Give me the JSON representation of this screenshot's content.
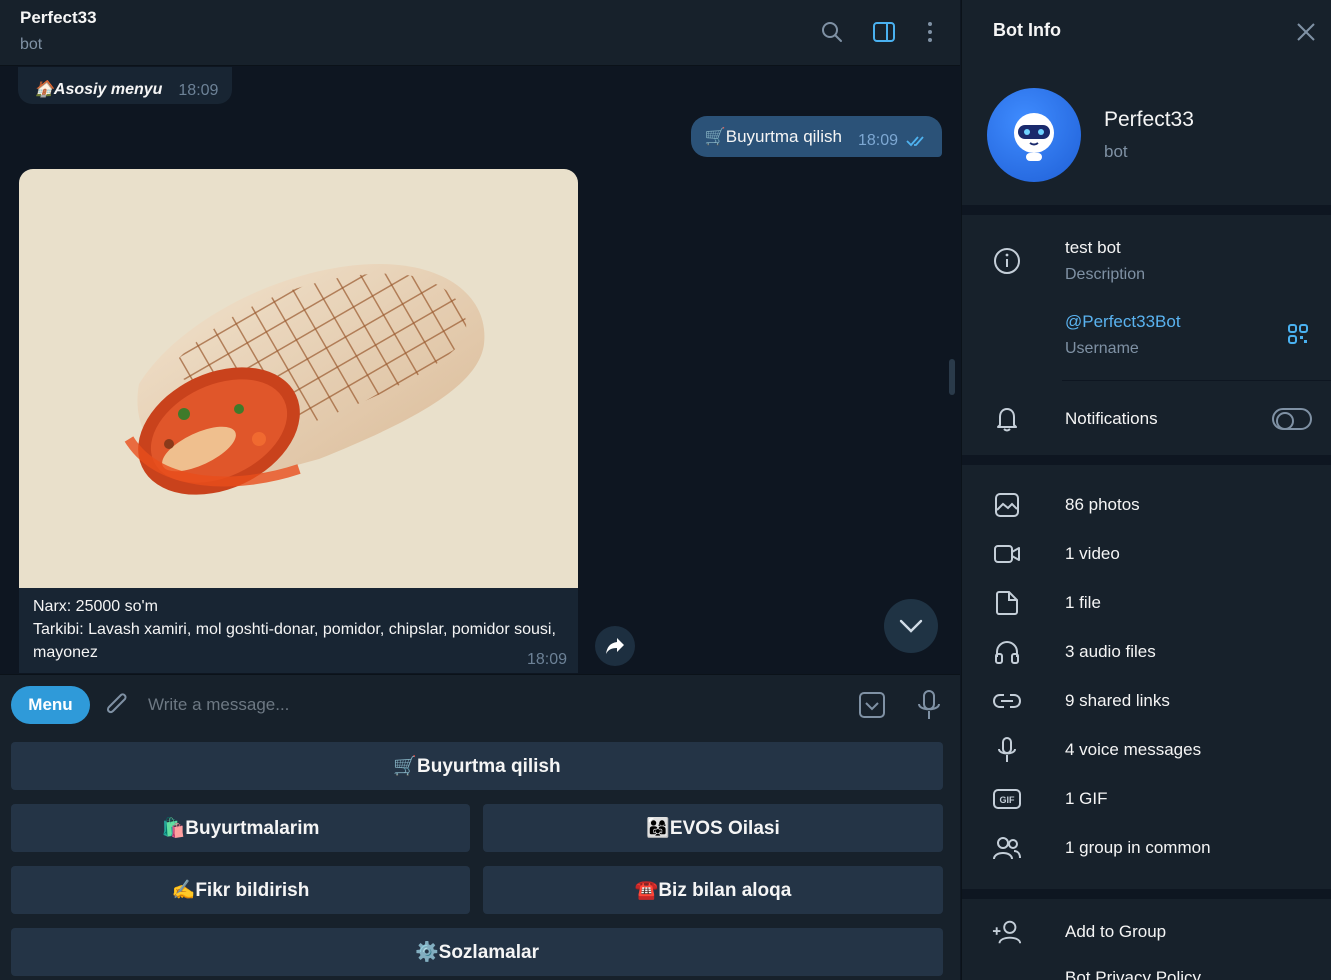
{
  "chat": {
    "title": "Perfect33",
    "subtitle": "bot",
    "icons": [
      "search-icon",
      "sidebar-toggle-icon",
      "more-vertical-icon"
    ]
  },
  "messages": {
    "incoming_small": {
      "text": "🏠Asosiy menyu",
      "time": "18:09"
    },
    "outgoing": {
      "text": "🛒Buyurtma qilish",
      "time": "18:09",
      "status": "read"
    },
    "photo_message": {
      "caption_line1": "Narx: 25000 so'm",
      "caption_line2": "Tarkibi: Lavash xamiri, mol goshti-donar, pomidor, chipslar, pomidor sousi, mayonez",
      "time": "18:09"
    }
  },
  "input": {
    "menu_label": "Menu",
    "placeholder": "Write a message..."
  },
  "keyboard": {
    "row1": "🛒Buyurtma qilish",
    "row2_left": "🛍️Buyurtmalarim",
    "row2_right": "👨‍👩‍👧EVOS Oilasi",
    "row3_left": "✍️Fikr bildirish",
    "row3_right": "☎️Biz bilan aloqa",
    "row4": "⚙️Sozlamalar"
  },
  "info": {
    "title": "Bot Info",
    "name": "Perfect33",
    "status": "bot",
    "description_value": "test bot",
    "description_label": "Description",
    "username_value": "@Perfect33Bot",
    "username_label": "Username",
    "notifications_label": "Notifications",
    "notifications_on": false,
    "media": [
      {
        "label": "86 photos",
        "icon": "photo-icon"
      },
      {
        "label": "1 video",
        "icon": "video-icon"
      },
      {
        "label": "1 file",
        "icon": "file-icon"
      },
      {
        "label": "3 audio files",
        "icon": "headphones-icon"
      },
      {
        "label": "9 shared links",
        "icon": "link-icon"
      },
      {
        "label": "4 voice messages",
        "icon": "microphone-icon"
      },
      {
        "label": "1 GIF",
        "icon": "gif-icon"
      },
      {
        "label": "1 group in common",
        "icon": "group-icon"
      }
    ],
    "add_to_group": "Add to Group",
    "privacy_policy": "Bot Privacy Policy"
  },
  "colors": {
    "accent": "#2f9ad9",
    "background": "#0e1621",
    "panel": "#17212b",
    "outgoing_bubble": "#2b5278",
    "incoming_bubble": "#182533",
    "link": "#5ab3f0"
  }
}
